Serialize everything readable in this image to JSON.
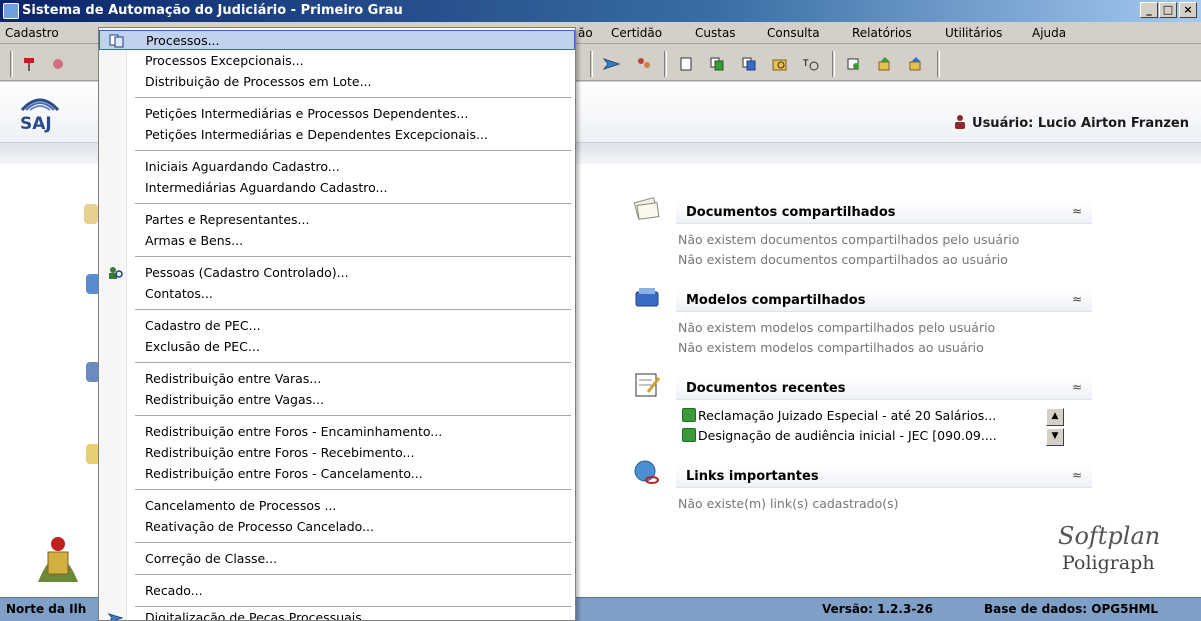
{
  "window": {
    "title": "Sistema de Automação do Judiciário - Primeiro Grau",
    "minimize": "_",
    "maximize": "□",
    "close": "×"
  },
  "menubar": {
    "items": [
      {
        "label": "Cadastro"
      },
      {
        "label": "ão"
      },
      {
        "label": "Certidão"
      },
      {
        "label": "Custas"
      },
      {
        "label": "Consulta"
      },
      {
        "label": "Relatórios"
      },
      {
        "label": "Utilitários"
      },
      {
        "label": "Ajuda"
      }
    ]
  },
  "dropdown": {
    "items": [
      {
        "label": "Processos...",
        "selected": true,
        "icon": "process-icon"
      },
      {
        "label": "Processos Excepcionais..."
      },
      {
        "label": "Distribuição de Processos em Lote..."
      },
      {
        "label": "Petições Intermediárias e Processos Dependentes..."
      },
      {
        "label": "Petições Intermediárias e Dependentes Excepcionais..."
      },
      {
        "label": "Iniciais Aguardando Cadastro..."
      },
      {
        "label": "Intermediárias Aguardando Cadastro..."
      },
      {
        "label": "Partes e Representantes..."
      },
      {
        "label": "Armas e Bens..."
      },
      {
        "label": "Pessoas (Cadastro Controlado)...",
        "icon": "people-search-icon"
      },
      {
        "label": "Contatos..."
      },
      {
        "label": "Cadastro de PEC..."
      },
      {
        "label": "Exclusão de PEC..."
      },
      {
        "label": "Redistribuição entre Varas..."
      },
      {
        "label": "Redistribuição entre Vagas..."
      },
      {
        "label": "Redistribuição entre Foros - Encaminhamento..."
      },
      {
        "label": "Redistribuição entre Foros - Recebimento..."
      },
      {
        "label": "Redistribuição entre Foros - Cancelamento..."
      },
      {
        "label": "Cancelamento de Processos ..."
      },
      {
        "label": "Reativação de Processo Cancelado..."
      },
      {
        "label": "Correção de Classe..."
      },
      {
        "label": "Recado..."
      },
      {
        "label": "Digitalização de Peças Processuais...",
        "icon": "scan-icon"
      }
    ]
  },
  "header": {
    "logo_text": "SAJ",
    "user": "Usuário: Lucio Airton Franzen"
  },
  "panels": {
    "shared_docs": {
      "title": "Documentos compartilhados",
      "collapse": "≈",
      "lines": [
        "Não existem documentos compartilhados pelo usuário",
        "Não existem documentos compartilhados ao usuário"
      ]
    },
    "shared_models": {
      "title": "Modelos compartilhados",
      "collapse": "≈",
      "lines": [
        "Não existem modelos compartilhados pelo usuário",
        "Não existem modelos compartilhados ao usuário"
      ]
    },
    "recent_docs": {
      "title": "Documentos recentes",
      "collapse": "≈",
      "items": [
        "Reclamação Juizado Especial - até 20 Salários...",
        "Designação de audiência inicial - JEC [090.09...."
      ]
    },
    "links": {
      "title": "Links importantes",
      "collapse": "≈",
      "lines": [
        "Não existe(m) link(s) cadastrado(s)"
      ]
    }
  },
  "branding": {
    "softplan": "Softplan",
    "poligraph": "Poligraph"
  },
  "statusbar": {
    "left": "Norte da Ilh",
    "version": "Versão: 1.2.3-26",
    "database": "Base de dados: OPG5HML"
  },
  "colors": {
    "titlebar": "#0a246a",
    "menu_highlight": "#c1d2ee",
    "statusbar": "#7f9fc7"
  }
}
